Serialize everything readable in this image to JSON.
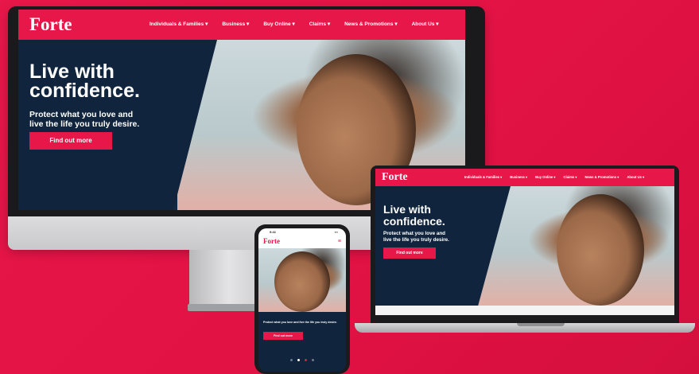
{
  "brand": {
    "name": "Forte",
    "accent": "#e8174a",
    "navy": "#10253d"
  },
  "nav": {
    "items": [
      "Individuals & Families ▾",
      "Business ▾",
      "Buy Online ▾",
      "Claims ▾",
      "News & Promotions ▾",
      "About Us ▾"
    ]
  },
  "hero": {
    "title_line1": "Live with",
    "title_line2": "confidence.",
    "subtitle_line1": "Protect what you love and",
    "subtitle_line2": "live the life you truly desire.",
    "cta_label": "Find out more"
  },
  "phone": {
    "time": "9:41",
    "signal": "▪▪▪",
    "menu_icon": "≡",
    "text": "Protect what you love and live the life you truly desire.",
    "cta_label": "Find out more"
  }
}
